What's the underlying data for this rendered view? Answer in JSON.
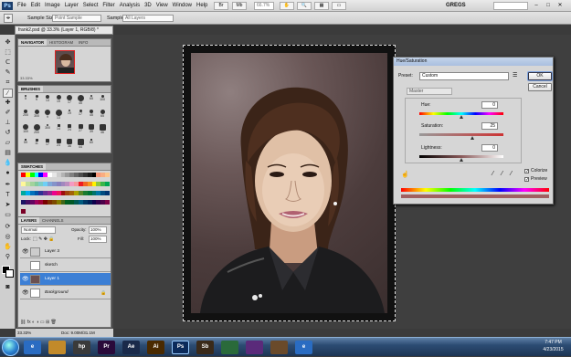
{
  "menubar": {
    "logo": "Ps",
    "items": [
      "File",
      "Edit",
      "Image",
      "Layer",
      "Select",
      "Filter",
      "Analysis",
      "3D",
      "View",
      "Window",
      "Help"
    ],
    "zoom": "66.7%",
    "workspace": "GREGS",
    "window_controls": [
      "–",
      "□",
      "✕"
    ]
  },
  "options": {
    "sample_size_label": "Sample Size:",
    "sample_size_value": "Point Sample",
    "sample_label": "Sample:",
    "sample_value": "All Layers"
  },
  "document": {
    "tab_title": "frank2.psd @ 33.3% (Layer 1, RGB/8) *"
  },
  "navigator": {
    "tabs": [
      "NAVIGATOR",
      "HISTOGRAM",
      "INFO"
    ],
    "zoom": "33.33%"
  },
  "brushes": {
    "tab": "BRUSHES",
    "sizes": [
      "5",
      "9",
      "13",
      "19",
      "17",
      "45",
      "65",
      "100",
      "200",
      "300",
      "9",
      "13",
      "19",
      "17",
      "45",
      "65",
      "100",
      "200",
      "300",
      "14",
      "24",
      "27",
      "39",
      "46",
      "59",
      "11",
      "17",
      "23",
      "36",
      "44",
      "60"
    ]
  },
  "swatches": {
    "tab": "SWATCHES",
    "colors": [
      "#ff0000",
      "#ffff00",
      "#00ff00",
      "#00ffff",
      "#0000ff",
      "#ff00ff",
      "#ffffff",
      "#e6e6e6",
      "#cccccc",
      "#b3b3b3",
      "#999999",
      "#808080",
      "#666666",
      "#4d4d4d",
      "#333333",
      "#1a1a1a",
      "#000000",
      "#f7977a",
      "#f9ad81",
      "#fdc68a",
      "#fff79a",
      "#c4df9b",
      "#a2d39c",
      "#82ca9d",
      "#7bcdc8",
      "#6ecff6",
      "#7ea7d8",
      "#8493ca",
      "#8882be",
      "#a187be",
      "#bc8dbf",
      "#f49ac2",
      "#f6989d",
      "#ed1c24",
      "#f26522",
      "#f7941d",
      "#fff200",
      "#8dc63f",
      "#39b54a",
      "#00a651",
      "#00a99d",
      "#00aeef",
      "#0072bc",
      "#0054a6",
      "#2e3192",
      "#662d91",
      "#92278f",
      "#ec008c",
      "#ed145b",
      "#9e0b0f",
      "#a0410d",
      "#a36209",
      "#aba000",
      "#598527",
      "#1a7b30",
      "#007236",
      "#00746b",
      "#0076a3",
      "#004b80",
      "#003471",
      "#1b1464",
      "#440e62",
      "#630460",
      "#9e005d",
      "#9e0039",
      "#790000",
      "#7b2e00",
      "#7d4900",
      "#827b00",
      "#406618",
      "#005e20",
      "#005826",
      "#005952",
      "#005b7f",
      "#003663",
      "#002157",
      "#0d004c",
      "#32004b",
      "#4b0049",
      "#7b0046",
      "#7a0026"
    ]
  },
  "layers": {
    "tabs": [
      "LAYERS",
      "CHANNELS"
    ],
    "blend_mode": "Normal",
    "opacity_label": "Opacity:",
    "opacity": "100%",
    "lock_label": "Lock:",
    "fill_label": "Fill:",
    "fill": "100%",
    "items": [
      {
        "name": "Layer 3"
      },
      {
        "name": "sketch"
      },
      {
        "name": "Layer 1"
      },
      {
        "name": "Background"
      }
    ]
  },
  "status": {
    "zoom": "33.33%",
    "doc": "Doc: 9.00M/31.1M"
  },
  "hue_sat": {
    "title": "Hue/Saturation",
    "preset_label": "Preset:",
    "preset": "Custom",
    "channel": "Master",
    "hue_label": "Hue:",
    "hue": "0",
    "saturation_label": "Saturation:",
    "saturation": "25",
    "lightness_label": "Lightness:",
    "lightness": "0",
    "ok": "OK",
    "cancel": "Cancel",
    "colorize": "Colorize",
    "preview": "Preview",
    "colorize_checked": true,
    "preview_checked": true
  },
  "taskbar": {
    "time": "7:47 PM",
    "date": "4/23/2015",
    "apps": [
      "e",
      "",
      "hp",
      "Pr",
      "Ae",
      "Ai",
      "Ps",
      "Sb",
      "",
      "",
      "",
      "e"
    ],
    "app_colors": [
      "#2a6cc2",
      "#c28a2a",
      "#3a3a3a",
      "#2a0a3a",
      "#1a2a4a",
      "#4a2a00",
      "#0b2a5a",
      "#3a2a1a",
      "#2a6a3a",
      "#5a2a7a",
      "#6a4a2a",
      "#2a6cc2"
    ]
  }
}
